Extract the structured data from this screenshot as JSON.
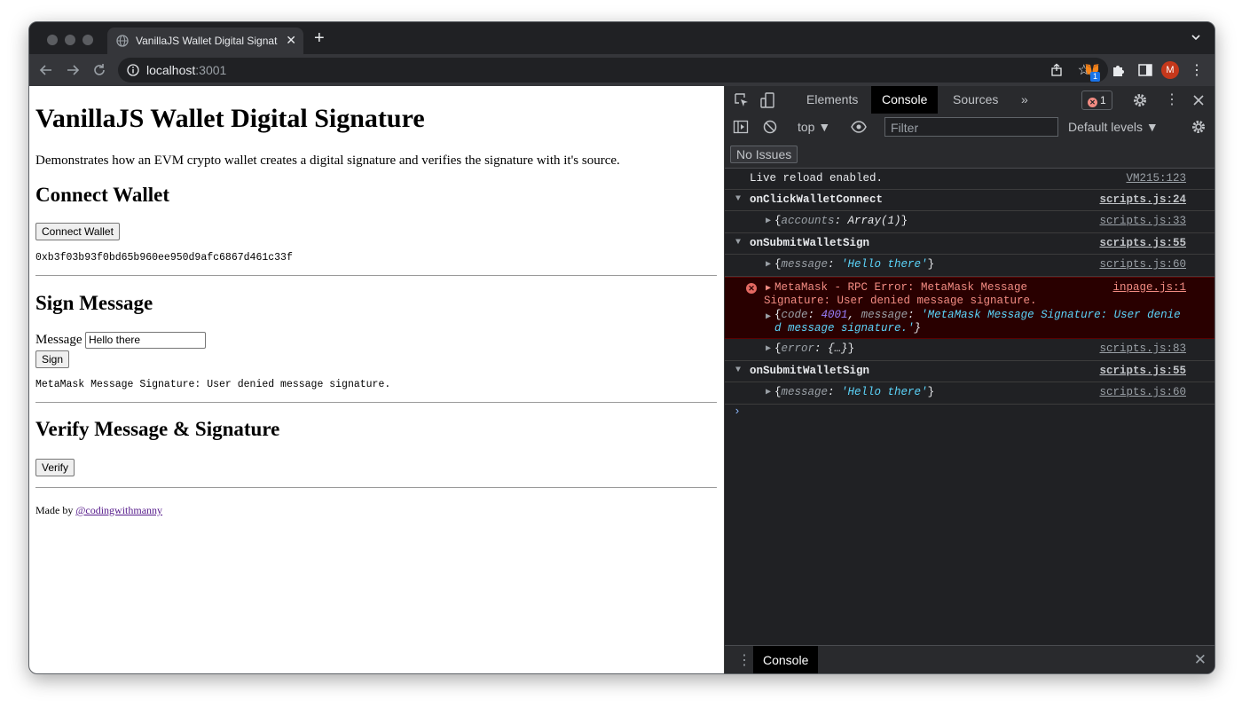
{
  "browser": {
    "tab_title": "VanillaJS Wallet Digital Signatu",
    "tab_close": "✕",
    "new_tab": "+",
    "url_host": "localhost",
    "url_port": ":3001",
    "extension_badge": "1",
    "profile_initial": "M"
  },
  "page": {
    "title": "VanillaJS Wallet Digital Signature",
    "description": "Demonstrates how an EVM crypto wallet creates a digital signature and verifies the signature with it's source.",
    "connect": {
      "heading": "Connect Wallet",
      "button": "Connect Wallet",
      "address": "0xb3f03b93f0bd65b960ee950d9afc6867d461c33f"
    },
    "sign": {
      "heading": "Sign Message",
      "label": "Message",
      "input_value": "Hello there",
      "button": "Sign",
      "result": "MetaMask Message Signature: User denied message signature."
    },
    "verify": {
      "heading": "Verify Message & Signature",
      "button": "Verify"
    },
    "footer": {
      "prefix": "Made by ",
      "link": "@codingwithmanny"
    }
  },
  "devtools": {
    "tabs": [
      "Elements",
      "Console",
      "Sources"
    ],
    "more": "»",
    "error_count": "1",
    "context": "top ▼",
    "filter_placeholder": "Filter",
    "levels": "Default levels ▼",
    "no_issues": "No Issues",
    "drawer_tab": "Console",
    "logs": {
      "live_reload": {
        "text": "Live reload enabled.",
        "src": "VM215:123"
      },
      "group1": {
        "name": "onClickWalletConnect",
        "src": "scripts.js:24"
      },
      "g1_obj": {
        "k": "accounts",
        "v": "Array(1)",
        "src": "scripts.js:33"
      },
      "group2": {
        "name": "onSubmitWalletSign",
        "src": "scripts.js:55"
      },
      "g2_obj": {
        "k": "message",
        "v": "'Hello there'",
        "src": "scripts.js:60"
      },
      "error": {
        "line1": "MetaMask - RPC Error: MetaMask Message",
        "line2": "Signature: User denied message signature.",
        "src": "inpage.js:1",
        "code_key": "code",
        "code_val": "4001",
        "msg_key": "message",
        "msg_val1": "'MetaMask Message Signature: User denie",
        "msg_val2": "d message signature.'"
      },
      "error_obj": {
        "k": "error",
        "v": "{…}",
        "src": "scripts.js:83"
      },
      "group3": {
        "name": "onSubmitWalletSign",
        "src": "scripts.js:55"
      },
      "g3_obj": {
        "k": "message",
        "v": "'Hello there'",
        "src": "scripts.js:60"
      },
      "prompt": "›"
    }
  }
}
